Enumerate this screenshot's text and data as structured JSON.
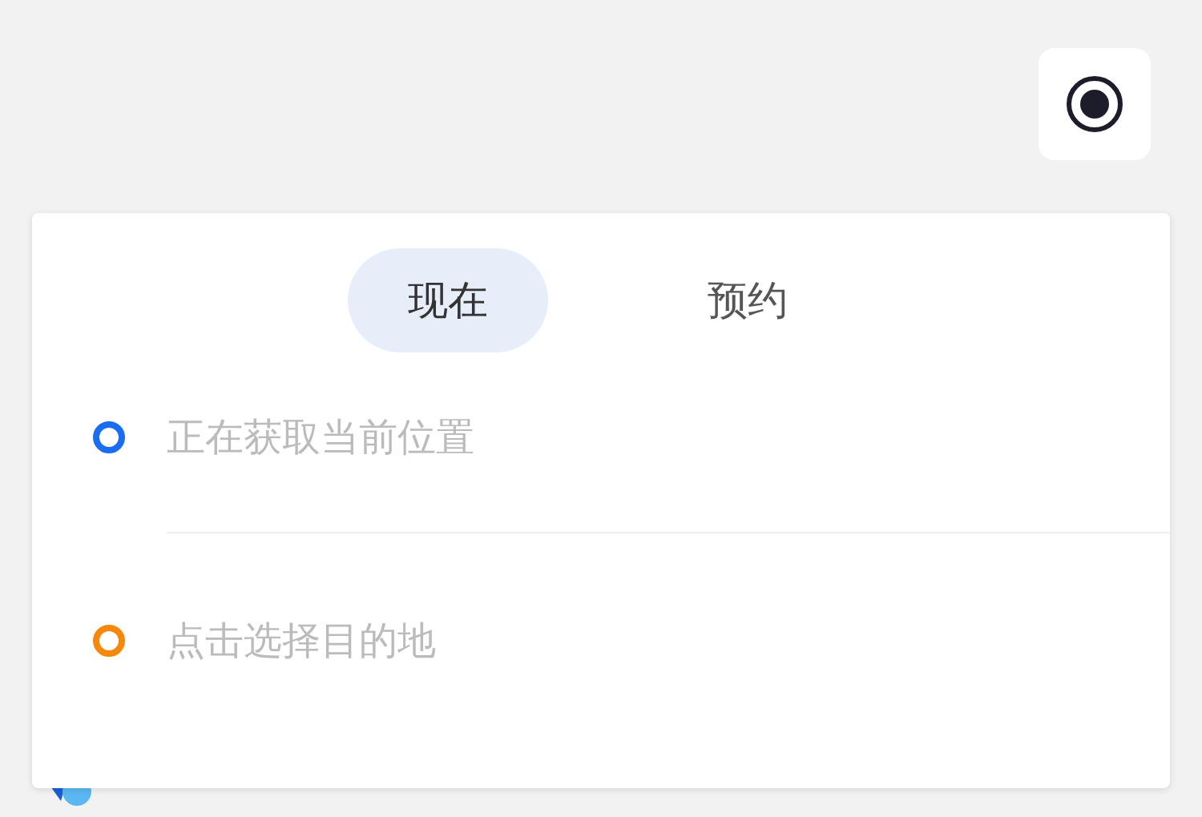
{
  "tabs": [
    {
      "label": "现在",
      "selected": true
    },
    {
      "label": "预约",
      "selected": false
    }
  ],
  "route": [
    {
      "placeholder": "正在获取当前位置",
      "color": "#1a6cf0"
    },
    {
      "placeholder": "点击选择目的地",
      "color": "#f5880a"
    }
  ]
}
